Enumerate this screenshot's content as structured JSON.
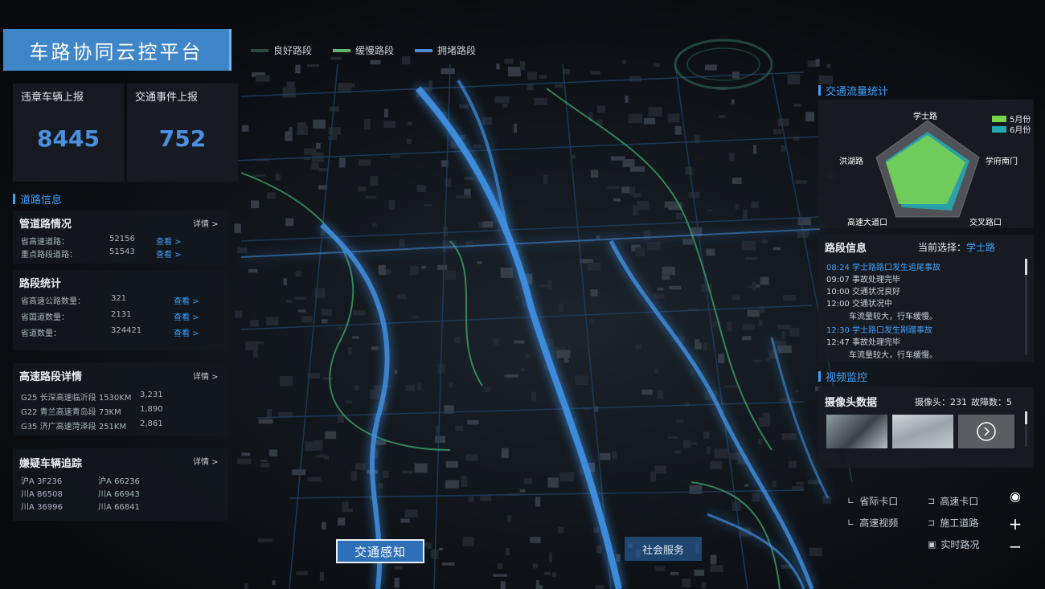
{
  "app": {
    "title": "车路协同云控平台"
  },
  "legend": [
    {
      "label": "良好路段",
      "color": "#2f4a3f"
    },
    {
      "label": "缓慢路段",
      "color": "#5fb56a"
    },
    {
      "label": "拥堵路段",
      "color": "#4a8cd6"
    }
  ],
  "stats": [
    {
      "label": "违章车辆上报",
      "value": "8445"
    },
    {
      "label": "交通事件上报",
      "value": "752"
    }
  ],
  "road_info": {
    "section_title": "道路信息",
    "overview": {
      "title": "管道路情况",
      "more": "详情 >",
      "rows": [
        {
          "name": "省高速道路：",
          "value": "52156",
          "link": "查看 >"
        },
        {
          "name": "重点路段道路：",
          "value": "51543",
          "link": "查看 >"
        }
      ]
    },
    "stats": {
      "title": "路段统计",
      "rows": [
        {
          "name": "省高速公路数量：",
          "value": "321",
          "link": "查看 >"
        },
        {
          "name": "省国道数量：",
          "value": "2131",
          "link": "查看 >"
        },
        {
          "name": "省道数量：",
          "value": "324421",
          "link": "查看 >"
        }
      ]
    }
  },
  "highway": {
    "title": "高速路段详情",
    "more": "详情 >",
    "rows": [
      {
        "name": "G25 长深高速临沂段 1530KM",
        "value": "3,231"
      },
      {
        "name": "G22 青兰高速青岛段 73KM",
        "value": "1,890"
      },
      {
        "name": "G35 济广高速菏泽段 251KM",
        "value": "2,861"
      }
    ]
  },
  "suspect": {
    "title": "嫌疑车辆追踪",
    "more": "详情 >",
    "plates": [
      "沪A 3F236",
      "沪A 66236",
      "川A 86508",
      "川A 66943",
      "川A 36996",
      "川A 66841"
    ]
  },
  "traffic_stats": {
    "section_title": "交通流量统计",
    "axes": [
      "学士路",
      "学府南门",
      "交叉路口",
      "高速大道口",
      "洪湖路"
    ],
    "series": [
      {
        "name": "5月份",
        "color": "#7bd44f"
      },
      {
        "name": "6月份",
        "color": "#27a7b0"
      }
    ]
  },
  "road_detail": {
    "title": "路段信息",
    "current_label": "当前选择：",
    "current_value": "学士路",
    "logs": [
      {
        "text": "08:24 学士路路口发生追尾事故",
        "highlight": true
      },
      {
        "text": "09:07 事故处理完毕",
        "highlight": false
      },
      {
        "text": "10:00 交通状况良好",
        "highlight": false
      },
      {
        "text": "12:00 交通状况中",
        "highlight": false
      },
      {
        "text": "车流量较大，行车缓慢。",
        "highlight": false,
        "indent": true
      },
      {
        "text": "12:30 学士路口发生剐蹭事故",
        "highlight": true
      },
      {
        "text": "12:47 事故处理完毕",
        "highlight": false
      },
      {
        "text": "车流量较大，行车缓慢。",
        "highlight": false,
        "indent": true
      }
    ]
  },
  "camera": {
    "section_title": "视频监控",
    "title": "摄像头数据",
    "count_label": "摄像头：231",
    "fault_label": "故障数：5"
  },
  "controls": [
    {
      "label": "省际卡口",
      "icon": "corner-icon"
    },
    {
      "label": "高速卡口",
      "icon": "bracket-icon"
    },
    {
      "label": "高速视频",
      "icon": "corner-icon"
    },
    {
      "label": "施工道路",
      "icon": "bracket-icon"
    },
    {
      "label": "实时路况",
      "icon": "square-icon"
    }
  ],
  "nav": {
    "perceive": "交通感知",
    "social": "社会服务"
  }
}
